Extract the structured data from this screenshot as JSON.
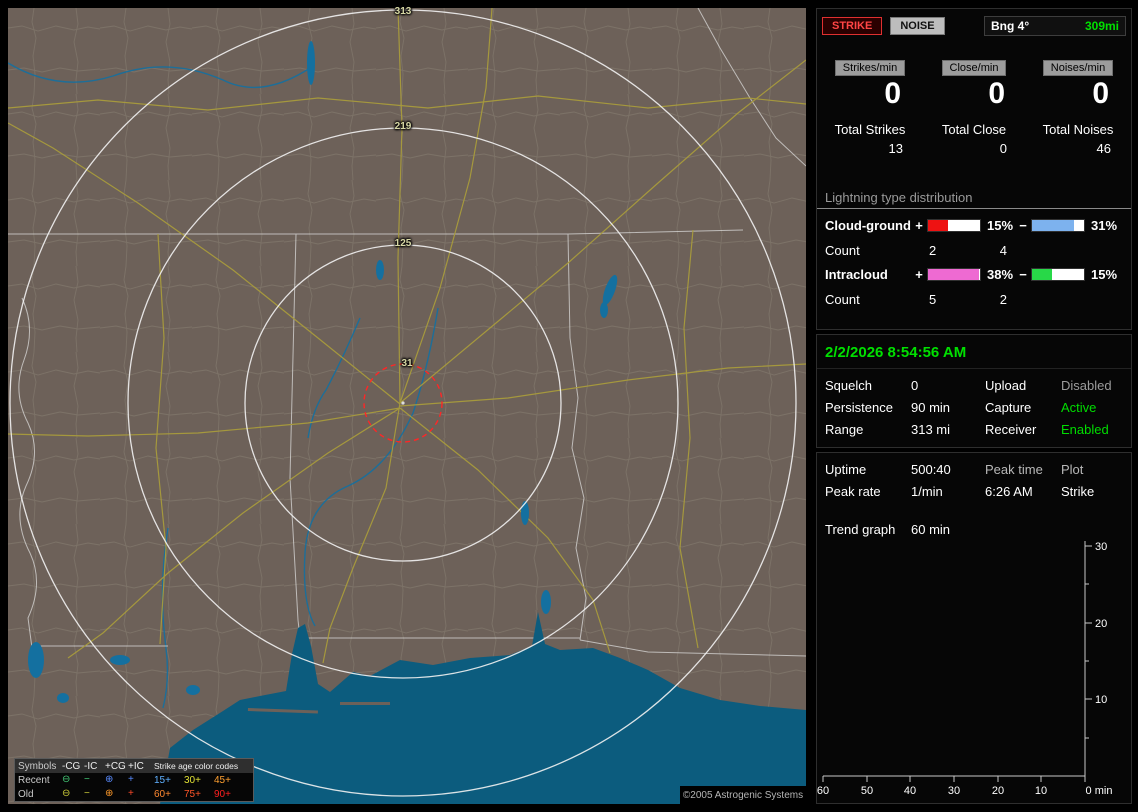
{
  "map": {
    "rings": [
      "313",
      "219",
      "125",
      "31"
    ],
    "copyright": "©2005 Astrogenic Systems",
    "colors": {
      "land": "#6d6159",
      "water": "#0c5c7e",
      "road": "#a89b3c",
      "range_ring": "#f2f2f2",
      "close_ring": "#ff2626"
    },
    "legend": {
      "symbols_header": "Symbols",
      "columns": [
        "-CG",
        "-IC",
        "+CG",
        "+IC"
      ],
      "age_header": "Strike age color codes",
      "recent_label": "Recent",
      "old_label": "Old",
      "recent_symbols": [
        {
          "glyph": "⊖",
          "color": "#44cc77"
        },
        {
          "glyph": "−",
          "color": "#44cc77"
        },
        {
          "glyph": "⊕",
          "color": "#5a8cff"
        },
        {
          "glyph": "+",
          "color": "#5a8cff"
        }
      ],
      "old_symbols": [
        {
          "glyph": "⊖",
          "color": "#cfcf3a"
        },
        {
          "glyph": "−",
          "color": "#cfcf3a"
        },
        {
          "glyph": "⊕",
          "color": "#ff9a2a"
        },
        {
          "glyph": "+",
          "color": "#ff4a2a"
        }
      ],
      "recent_ages": [
        {
          "text": "15+",
          "color": "#5fb0ff"
        },
        {
          "text": "30+",
          "color": "#e0e034"
        },
        {
          "text": "45+",
          "color": "#ffa030"
        }
      ],
      "old_ages": [
        {
          "text": "60+",
          "color": "#ff8830"
        },
        {
          "text": "75+",
          "color": "#ff5528"
        },
        {
          "text": "90+",
          "color": "#ff2020"
        }
      ]
    }
  },
  "panel": {
    "strike_button": "STRIKE",
    "noise_button": "NOISE",
    "bearing_label": "Bng 4°",
    "bearing_value": "309mi",
    "counters": [
      {
        "label": "Strikes/min",
        "value": "0",
        "total_label": "Total Strikes",
        "total_value": "13"
      },
      {
        "label": "Close/min",
        "value": "0",
        "total_label": "Total Close",
        "total_value": "0"
      },
      {
        "label": "Noises/min",
        "value": "0",
        "total_label": "Total Noises",
        "total_value": "46"
      }
    ],
    "distribution": {
      "title": "Lightning type distribution",
      "plus": "+",
      "minus": "−",
      "count_label": "Count",
      "cg": {
        "label": "Cloud-ground",
        "plus_pct": "15%",
        "plus_val": 15,
        "plus_color": "#ee1212",
        "plus_count": "2",
        "minus_pct": "31%",
        "minus_val": 31,
        "minus_color": "#7db2ee",
        "minus_count": "4"
      },
      "ic": {
        "label": "Intracloud",
        "plus_pct": "38%",
        "plus_val": 38,
        "plus_color": "#ee6ad2",
        "plus_count": "5",
        "minus_pct": "15%",
        "minus_val": 15,
        "minus_color": "#28d848",
        "minus_count": "2"
      }
    },
    "status": {
      "datetime": "2/2/2026 8:54:56 AM",
      "squelch_label": "Squelch",
      "squelch": "0",
      "persistence_label": "Persistence",
      "persistence": "90 min",
      "range_label": "Range",
      "range": "313 mi",
      "upload_label": "Upload",
      "upload": "Disabled",
      "upload_color": "#9c9c9c",
      "capture_label": "Capture",
      "capture": "Active",
      "capture_color": "#00dd00",
      "receiver_label": "Receiver",
      "receiver": "Enabled",
      "receiver_color": "#00dd00"
    },
    "stats": {
      "uptime_label": "Uptime",
      "uptime": "500:40",
      "peak_time_label": "Peak time",
      "peak_time": "6:26 AM",
      "peak_rate_label": "Peak rate",
      "peak_rate": "1/min",
      "plot_label": "Plot",
      "plot_value": "Strike",
      "trend_label": "Trend graph",
      "trend_value": "60 min"
    }
  },
  "chart_data": {
    "type": "line",
    "title": "Trend graph (60 min)",
    "xlabel": "min",
    "ylabel": "",
    "xlim": [
      60,
      0
    ],
    "ylim": [
      0,
      30
    ],
    "x_ticks": [
      "60",
      "50",
      "40",
      "30",
      "20",
      "10",
      "0 min"
    ],
    "y_ticks": [
      "30",
      "20",
      "10"
    ],
    "series": []
  }
}
